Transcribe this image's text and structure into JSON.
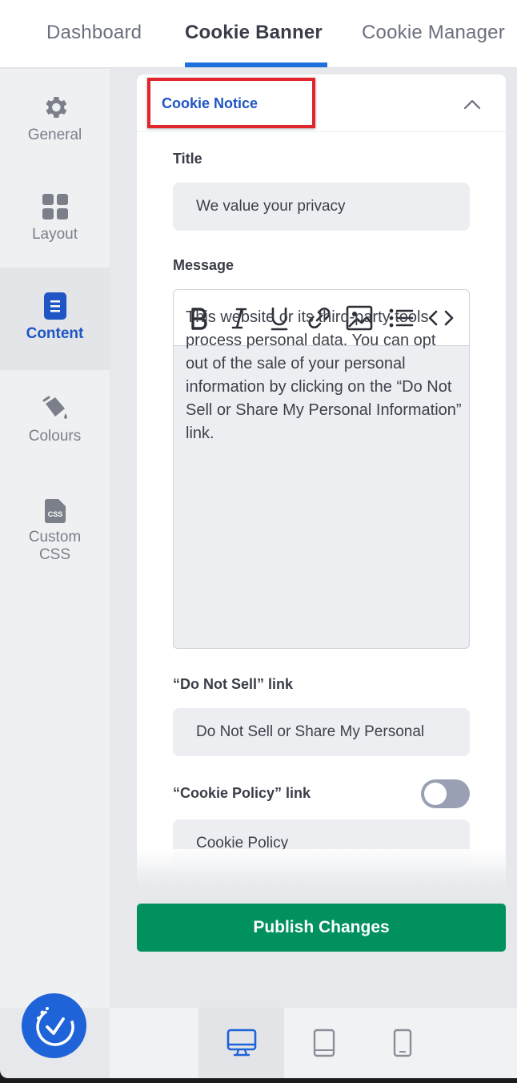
{
  "top_tabs": {
    "dashboard": "Dashboard",
    "cookie_banner": "Cookie Banner",
    "cookie_manager": "Cookie Manager"
  },
  "sidebar": {
    "items": [
      {
        "label": "General",
        "icon": "gear-icon"
      },
      {
        "label": "Layout",
        "icon": "grid-icon"
      },
      {
        "label": "Content",
        "icon": "document-icon",
        "active": true
      },
      {
        "label": "Colours",
        "icon": "paint-bucket-icon"
      },
      {
        "label": "Custom CSS",
        "icon": "css-file-icon"
      }
    ]
  },
  "panel": {
    "title": "Cookie Notice",
    "title_field": {
      "label": "Title",
      "value": "We value your privacy"
    },
    "message_field": {
      "label": "Message",
      "toolbar": [
        "bold",
        "italic",
        "underline",
        "link",
        "image",
        "bullet-list",
        "code"
      ],
      "value": "This website or its third-party tools process personal data. You can opt out of the sale of your personal information by clicking on the “Do Not Sell or Share My Personal Information” link."
    },
    "do_not_sell": {
      "label": "“Do Not Sell” link",
      "value": "Do Not Sell or Share My Personal"
    },
    "cookie_policy": {
      "label": "“Cookie Policy” link",
      "value": "Cookie Policy",
      "toggle_on": false
    }
  },
  "actions": {
    "publish": "Publish Changes"
  },
  "device_preview": [
    "desktop",
    "tablet",
    "mobile"
  ],
  "colors": {
    "accent": "#1f55c4",
    "publish": "#00915f",
    "highlight": "#e0262c"
  }
}
